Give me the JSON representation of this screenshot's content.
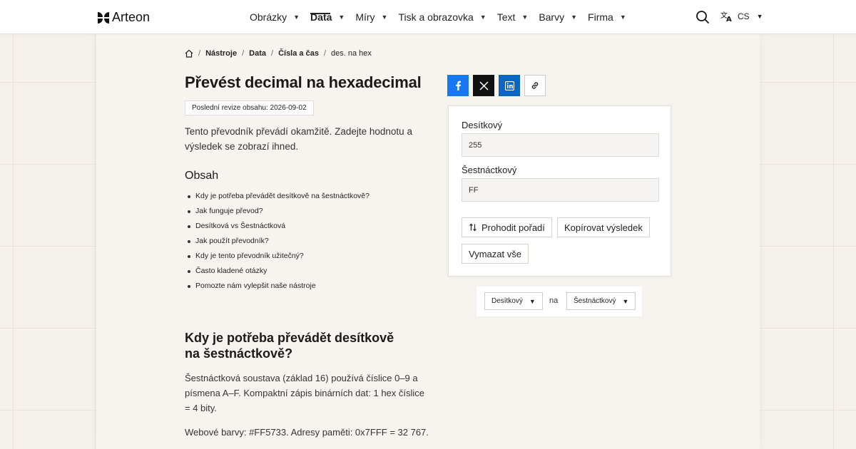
{
  "brand": {
    "name": "Arteon"
  },
  "nav": {
    "items": [
      {
        "label": "Obrázky",
        "active": false
      },
      {
        "label": "Data",
        "active": true
      },
      {
        "label": "Míry",
        "active": false
      },
      {
        "label": "Tisk a obrazovka",
        "active": false
      },
      {
        "label": "Text",
        "active": false
      },
      {
        "label": "Barvy",
        "active": false
      },
      {
        "label": "Firma",
        "active": false
      }
    ],
    "search_icon": "search-icon",
    "language": "CS",
    "language_icon": "translate-icon"
  },
  "breadcrumb": {
    "items": [
      "Nástroje",
      "Data",
      "Čísla a čas",
      "des. na hex"
    ]
  },
  "page": {
    "title": "Převést decimal na hexadecimal",
    "revision": "Poslední revize obsahu: 2026-09-02",
    "intro": "Tento převodník převádí okamžitě. Zadejte hodnotu a výsledek se zobrazí ihned."
  },
  "toc": {
    "title": "Obsah",
    "items": [
      "Kdy je potřeba převádět desítkově na šestnáctkově?",
      "Jak funguje převod?",
      "Desítková vs Šestnáctková",
      "Jak použít převodník?",
      "Kdy je tento převodník užitečný?",
      "Často kladené otázky",
      "Pomozte nám vylepšit naše nástroje"
    ]
  },
  "section": {
    "heading": "Kdy je potřeba převádět desítkově na šestnáctkově?",
    "para1": "Šestnáctková soustava (základ 16) používá číslice 0–9 a písmena A–F. Kompaktní zápis binárních dat: 1 hex číslice = 4 bity.",
    "para2": "Webové barvy: #FF5733. Adresy paměti: 0x7FFF = 32 767."
  },
  "share": {
    "icons": [
      "facebook-icon",
      "x-icon",
      "linkedin-icon",
      "link-icon"
    ]
  },
  "converter": {
    "decimal_label": "Desítkový",
    "decimal_value": "255",
    "hex_label": "Šestnáctkový",
    "hex_value": "FF",
    "swap_label": "Prohodit pořadí",
    "copy_label": "Kopírovat výsledek",
    "clear_label": "Vymazat vše"
  },
  "direction": {
    "from": "Desítkový",
    "joiner": "na",
    "to": "Šestnáctkový"
  }
}
